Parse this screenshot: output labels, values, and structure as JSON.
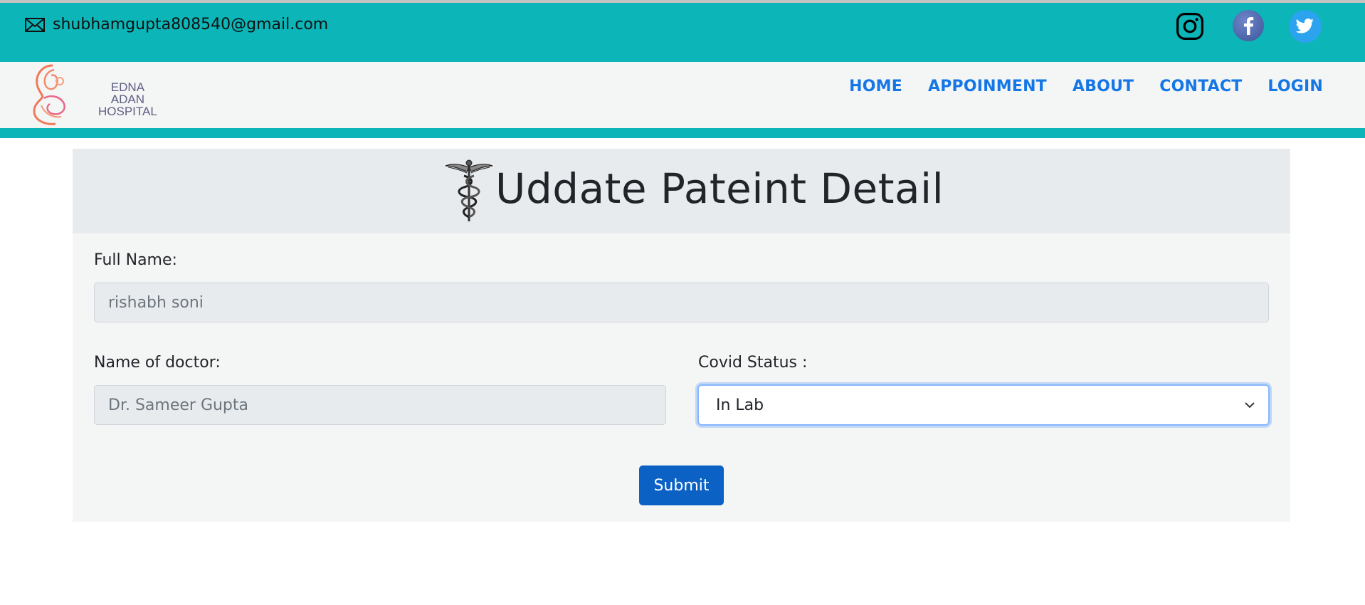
{
  "topbar": {
    "email": "shubhamgupta808540@gmail.com",
    "icons": [
      "mail-icon",
      "instagram-icon",
      "facebook-icon",
      "twitter-icon"
    ]
  },
  "brand": {
    "name_line1": "EDNA ADAN",
    "name_line2": "HOSPITAL"
  },
  "nav": {
    "items": [
      "HOME",
      "APPOINMENT",
      "ABOUT",
      "CONTACT",
      "LOGIN"
    ]
  },
  "form": {
    "title": "Uddate Pateint Detail",
    "full_name_label": "Full Name:",
    "full_name_value": "rishabh soni",
    "doctor_label": "Name of doctor:",
    "doctor_value": "Dr. Sameer Gupta",
    "covid_label": "Covid Status :",
    "covid_selected": "In Lab",
    "submit_label": "Submit"
  },
  "colors": {
    "teal": "#0bb5b8",
    "nav_link": "#1577e6",
    "submit": "#0b61c4"
  }
}
